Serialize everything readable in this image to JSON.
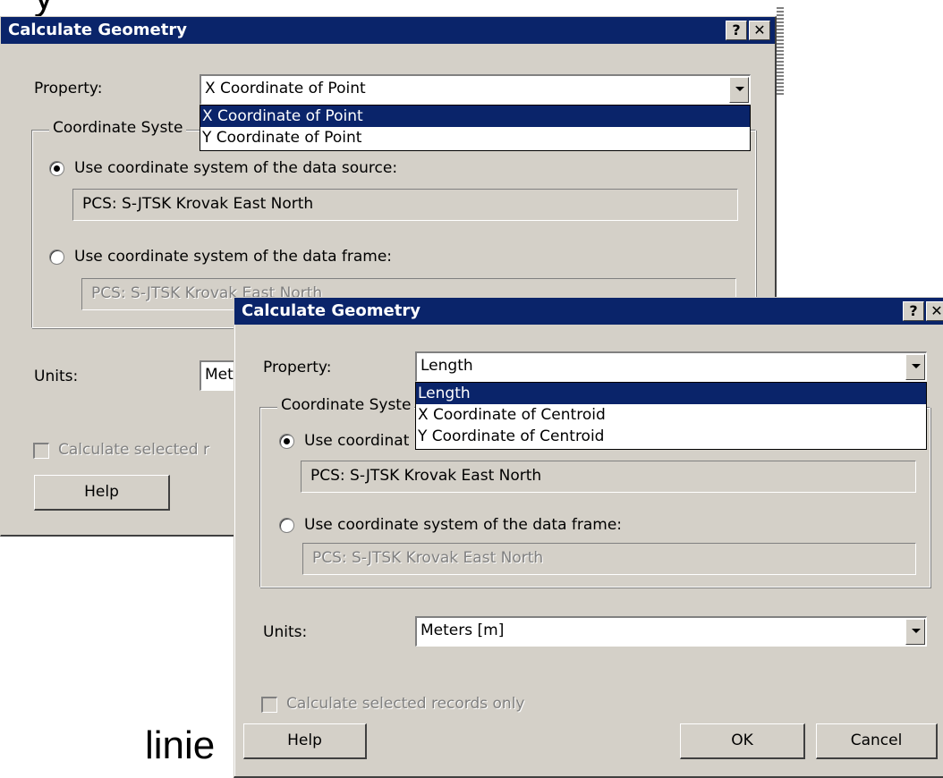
{
  "slide": {
    "top_text": "y",
    "bottom_label": "linie"
  },
  "dialog_point": {
    "title": "Calculate Geometry",
    "help_button": "?",
    "close_button": "✕",
    "property_label": "Property:",
    "property_value": "X Coordinate of Point",
    "property_options": [
      "X Coordinate of Point",
      "Y Coordinate of Point"
    ],
    "coord_group_title": "Coordinate Syste",
    "radio_source_label": "Use coordinate system of the data source:",
    "source_cs": "PCS: S-JTSK Krovak East North",
    "radio_frame_label": "Use coordinate system of the data frame:",
    "frame_cs": "PCS: S-JTSK Krovak East North",
    "units_label": "Units:",
    "units_value": "Met",
    "selected_only_label": "Calculate selected r",
    "help_label": "Help"
  },
  "dialog_line": {
    "title": "Calculate Geometry",
    "help_button": "?",
    "close_button": "✕",
    "property_label": "Property:",
    "property_value": "Length",
    "property_options": [
      "Length",
      "X Coordinate of Centroid",
      "Y Coordinate of Centroid"
    ],
    "coord_group_title": "Coordinate Syste",
    "radio_source_label": "Use coordinat",
    "source_cs": "PCS: S-JTSK Krovak East North",
    "radio_frame_label": "Use coordinate system of the data frame:",
    "frame_cs": "PCS: S-JTSK Krovak East North",
    "units_label": "Units:",
    "units_value": "Meters [m]",
    "selected_only_label": "Calculate selected records only",
    "help_label": "Help",
    "ok_label": "OK",
    "cancel_label": "Cancel"
  },
  "colors": {
    "title_bar": "#0a246a",
    "dialog_face": "#d4d0c8",
    "selection": "#0a246a"
  }
}
